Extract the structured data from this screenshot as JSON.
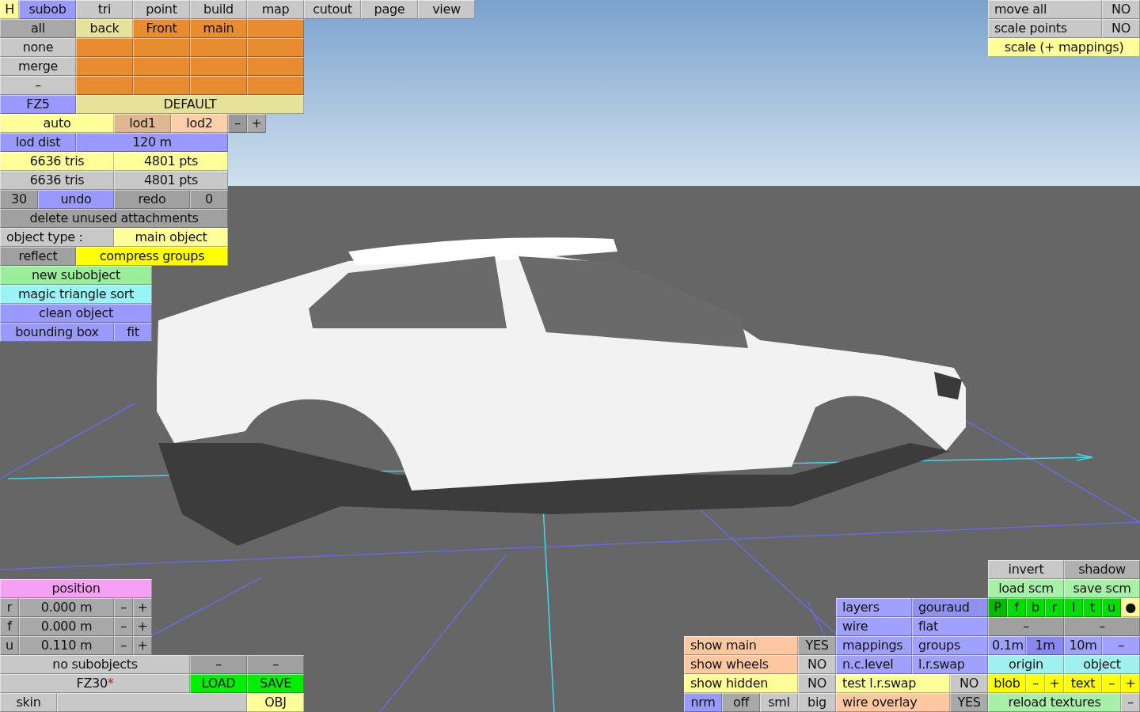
{
  "subobject_panel": {
    "buttons": [
      {
        "label": "H",
        "color": "#ffff99"
      },
      {
        "label": "subob",
        "color": "#9999ff"
      },
      {
        "label": "tri",
        "color": "#c8c8c8"
      },
      {
        "label": "point",
        "color": "#c8c8c8"
      },
      {
        "label": "build",
        "color": "#c8c8c8"
      },
      {
        "label": "map",
        "color": "#c8c8c8"
      },
      {
        "label": "cutout",
        "color": "#c8c8c8"
      },
      {
        "label": "page",
        "color": "#c8c8c8"
      },
      {
        "label": "view",
        "color": "#c8c8c8"
      },
      {
        "label": "all",
        "color": "#a8a8a8"
      },
      {
        "label": "back",
        "color": "#e6e29a"
      },
      {
        "label": "Front",
        "color": "#e88c30"
      },
      {
        "label": "main",
        "color": "#e88c30"
      },
      {
        "color": "#e88c30"
      },
      {
        "label": "none",
        "color": "#c8c8c8"
      },
      {
        "color": "#e88c30"
      },
      {
        "color": "#e88c30"
      },
      {
        "color": "#e88c30"
      },
      {
        "color": "#e88c30"
      },
      {
        "label": "merge",
        "color": "#c8c8c8"
      },
      {
        "color": "#e88c30"
      },
      {
        "color": "#e88c30"
      },
      {
        "color": "#e88c30"
      },
      {
        "color": "#e88c30"
      },
      {
        "label": "–",
        "color": "#c8c8c8"
      },
      {
        "color": "#e88c30"
      },
      {
        "color": "#e88c30"
      },
      {
        "color": "#e88c30"
      },
      {
        "color": "#e88c30"
      },
      {
        "label": "FZ5",
        "color": "#9999ff"
      },
      {
        "label": "DEFAULT",
        "color": "#e6e29a"
      },
      {
        "label": "auto",
        "color": "#ffff99"
      },
      {
        "label": "lod1",
        "color": "#e0b890"
      },
      {
        "label": "lod2",
        "color": "#ffd0a8"
      },
      {
        "label": "–",
        "color": "#999999"
      },
      {
        "label": "+",
        "color": "#a8a8a8"
      },
      {
        "label": "lod dist",
        "color": "#9999ff"
      },
      {
        "label": "120 m",
        "color": "#9999ff"
      },
      {
        "label": "6636 tris",
        "color": "#ffff99"
      },
      {
        "label": "4801 pts",
        "color": "#ffff99"
      },
      {
        "label": "6636 tris",
        "color": "#c8c8c8"
      },
      {
        "label": "4801 pts",
        "color": "#c8c8c8"
      },
      {
        "label": "30",
        "color": "#a0a0a0"
      },
      {
        "label": "undo",
        "color": "#9999ff"
      },
      {
        "label": "redo",
        "color": "#a0a0a0"
      },
      {
        "label": "0",
        "color": "#a0a0a0"
      },
      {
        "label": "delete unused attachments",
        "color": "#a0a0a0"
      },
      {
        "label": "object type :",
        "color": "#c8c8c8"
      },
      {
        "label": "main object",
        "color": "#ffff99"
      },
      {
        "label": "reflect",
        "color": "#a0a0a0"
      },
      {
        "label": "compress groups",
        "color": "#ffff00"
      },
      {
        "label": "new subobject",
        "color": "#99ee99"
      },
      {
        "label": "magic triangle sort",
        "color": "#99f5f5"
      },
      {
        "label": "clean object",
        "color": "#9999ff"
      },
      {
        "label": "bounding box",
        "color": "#9999ff"
      },
      {
        "label": "fit",
        "color": "#9999ff"
      }
    ]
  },
  "transform_panel": {
    "buttons": [
      {
        "label": "move all",
        "color": "#c8c8c8"
      },
      {
        "label": "NO",
        "color": "#c8c8c8"
      },
      {
        "label": "scale points",
        "color": "#c8c8c8"
      },
      {
        "label": "NO",
        "color": "#c8c8c8"
      },
      {
        "label": "scale (+ mappings)",
        "color": "#ffff99"
      }
    ]
  },
  "position_panel": {
    "buttons": [
      {
        "label": "position",
        "color": "#f5a0f5"
      },
      {
        "label": "r",
        "color": "#a8a8a8"
      },
      {
        "label": "0.000 m",
        "color": "#a8a8a8"
      },
      {
        "label": "–",
        "color": "#a8a8a8"
      },
      {
        "label": "+",
        "color": "#a8a8a8"
      },
      {
        "label": "f",
        "color": "#a8a8a8"
      },
      {
        "label": "0.000 m",
        "color": "#a8a8a8"
      },
      {
        "label": "–",
        "color": "#a8a8a8"
      },
      {
        "label": "+",
        "color": "#a8a8a8"
      },
      {
        "label": "u",
        "color": "#a8a8a8"
      },
      {
        "label": "0.110 m",
        "color": "#a8a8a8"
      },
      {
        "label": "–",
        "color": "#a8a8a8"
      },
      {
        "label": "+",
        "color": "#a8a8a8"
      },
      {
        "label": "no subobjects",
        "color": "#c8c8c8"
      },
      {
        "label": "–",
        "color": "#a0a0a0"
      },
      {
        "label": "–",
        "color": "#a0a0a0"
      },
      {
        "label": "FZ30",
        "suffix": "*",
        "color": "#c8c8c8"
      },
      {
        "label": "LOAD",
        "color": "#00ee00"
      },
      {
        "label": "SAVE",
        "color": "#00ee00"
      },
      {
        "label": "skin",
        "color": "#c8c8c8"
      },
      {
        "color": "#c8c8c8"
      },
      {
        "label": "OBJ",
        "color": "#ffff99"
      }
    ]
  },
  "visibility_panel": {
    "buttons": [
      {
        "label": "show main",
        "color": "#ffc8a0"
      },
      {
        "label": "YES",
        "color": "#a8a8a8"
      },
      {
        "label": "show wheels",
        "color": "#ffc8a0"
      },
      {
        "label": "NO",
        "color": "#c8c8c8"
      },
      {
        "label": "show hidden",
        "color": "#ffff99"
      },
      {
        "label": "NO",
        "color": "#c8c8c8"
      },
      {
        "label": "nrm",
        "color": "#9999ff"
      },
      {
        "label": "off",
        "color": "#a8a8a8"
      },
      {
        "label": "sml",
        "color": "#c8c8c8"
      },
      {
        "label": "big",
        "color": "#c8c8c8"
      }
    ]
  },
  "render_panel": {
    "buttons": [
      {
        "label": "layers",
        "color": "#a0a0ff"
      },
      {
        "label": "gouraud",
        "color": "#9090ee"
      },
      {
        "label": "wire",
        "color": "#a0a0ff"
      },
      {
        "label": "flat",
        "color": "#a0a0ff"
      },
      {
        "label": "mappings",
        "color": "#a0a0ff"
      },
      {
        "label": "groups",
        "color": "#a0a0ff"
      },
      {
        "label": "n.c.level",
        "color": "#a0a0ff"
      },
      {
        "label": "l.r.swap",
        "color": "#a0a0ff"
      },
      {
        "label": "test l.r.swap",
        "color": "#ffff99"
      },
      {
        "label": "NO",
        "color": "#c8c8c8"
      },
      {
        "label": "wire overlay",
        "color": "#ffc8a0"
      },
      {
        "label": "YES",
        "color": "#a8a8a8"
      }
    ]
  },
  "view_panel": {
    "buttons": [
      {
        "label": "invert",
        "color": "#c8c8c8"
      },
      {
        "label": "shadow",
        "color": "#b0b0b0"
      },
      {
        "label": "load scm",
        "color": "#a8f0a8"
      },
      {
        "label": "save scm",
        "color": "#a8f0a8"
      },
      {
        "label": "P",
        "color": "#00bb00"
      },
      {
        "label": "f",
        "color": "#00dd00"
      },
      {
        "label": "b",
        "color": "#00dd00"
      },
      {
        "label": "r",
        "color": "#00dd00"
      },
      {
        "label": "l",
        "color": "#00dd00"
      },
      {
        "label": "t",
        "color": "#00dd00"
      },
      {
        "label": "u",
        "color": "#00dd00"
      },
      {
        "label": "●",
        "color": "#ffff99"
      },
      {
        "label": "–",
        "color": "#a0a0a0"
      },
      {
        "label": "–",
        "color": "#a0a0a0"
      },
      {
        "label": "0.1m",
        "color": "#a0a0ff"
      },
      {
        "label": "1m",
        "color": "#8888ee"
      },
      {
        "label": "10m",
        "color": "#a0a0ff"
      },
      {
        "label": "–",
        "color": "#a0a0ff"
      },
      {
        "label": "origin",
        "color": "#a0f0f0"
      },
      {
        "label": "object",
        "color": "#a0f0f0"
      },
      {
        "label": "blob",
        "color": "#ffff00"
      },
      {
        "label": "–",
        "color": "#ffff00"
      },
      {
        "label": "+",
        "color": "#ffff00"
      },
      {
        "label": "text",
        "color": "#ffff00"
      },
      {
        "label": "–",
        "color": "#ffff00"
      },
      {
        "label": "+",
        "color": "#ffff00"
      },
      {
        "label": "reload textures",
        "color": "#a8f0a8"
      },
      {
        "label": "–",
        "color": "#c8c8c8"
      }
    ]
  }
}
